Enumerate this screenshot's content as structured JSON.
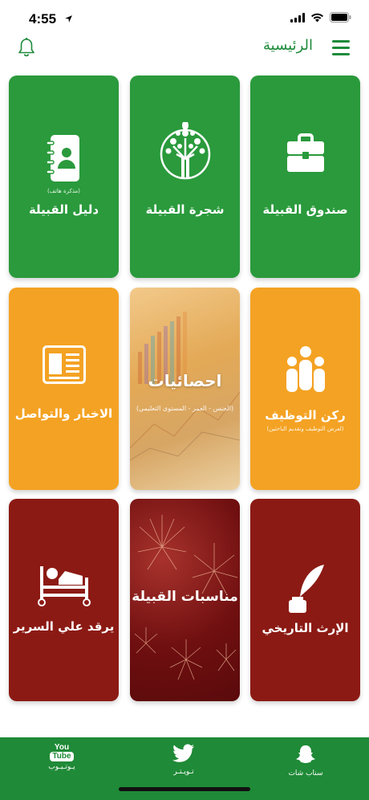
{
  "status_bar": {
    "time": "4:55"
  },
  "header": {
    "title": "الرئيسية"
  },
  "tiles": [
    {
      "label": "صندوق القبيلة",
      "icon": "briefcase-icon",
      "color": "#2a9a3c"
    },
    {
      "label": "شجرة القبيلة",
      "icon": "family-tree-icon",
      "color": "#2a9a3c"
    },
    {
      "label": "دليل القبيلة",
      "sub": "(مذكرة هاتف)",
      "icon": "contact-book-icon",
      "color": "#2a9a3c"
    },
    {
      "label": "ركن التوظيف",
      "sub": "(لعرض التوظيف وتقديم الباحثين)",
      "icon": "people-icon",
      "color": "#f4a223"
    },
    {
      "label": "احصائيات",
      "sub": "(الجنس - العمر - المستوى التعليمي)",
      "icon": "chart-photo-icon",
      "color": "#e3a956"
    },
    {
      "label": "الاخبار والتواصل",
      "icon": "newspaper-icon",
      "color": "#f4a223"
    },
    {
      "label": "الإرث التاريخي",
      "icon": "quill-inkwell-icon",
      "color": "#8c1a14"
    },
    {
      "label": "مناسبات القبيلة",
      "icon": "fireworks-photo-icon",
      "color": "#6f0f10"
    },
    {
      "label": "يرقد علي السرير",
      "icon": "hospital-bed-icon",
      "color": "#8c1a14"
    }
  ],
  "tabbar": {
    "items": [
      {
        "label": "سناب شات",
        "icon": "snapchat-icon"
      },
      {
        "label": "تـويـتـر",
        "icon": "twitter-icon"
      },
      {
        "label": "يـوتـيـوب",
        "icon": "youtube-icon",
        "logo_text_top": "You",
        "logo_text_bottom": "Tube"
      }
    ]
  },
  "colors": {
    "brand_green": "#1e8a3a",
    "tile_green": "#2a9a3c",
    "tile_orange": "#f4a223",
    "tile_maroon": "#8c1a14"
  }
}
